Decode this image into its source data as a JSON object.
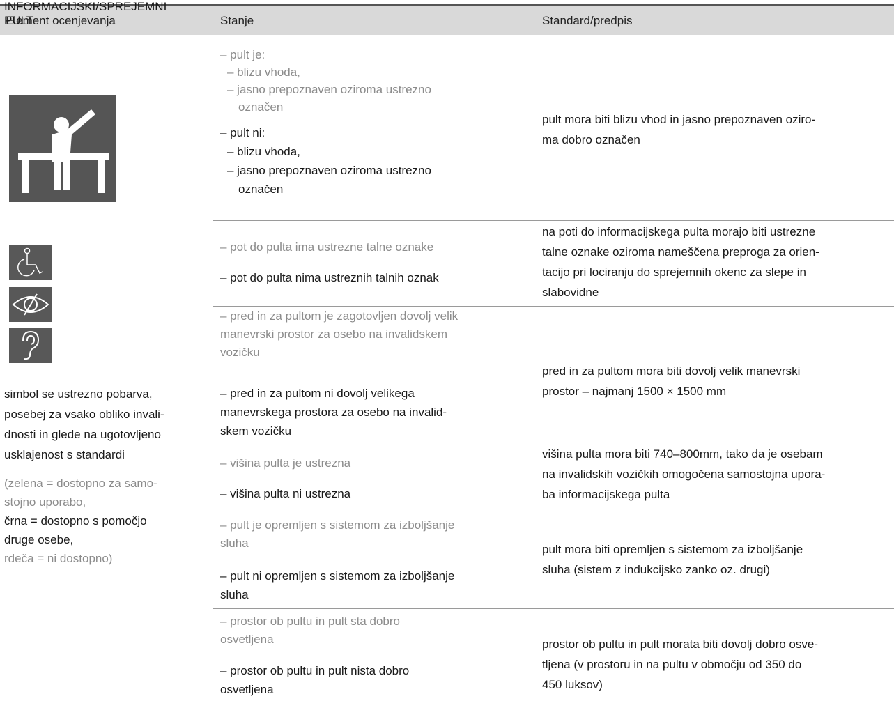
{
  "header": {
    "col1": "Element ocenjevanja",
    "col2": "Stanje",
    "col3": "Standard/predpis"
  },
  "left": {
    "title_line1": "INFORMACIJSKI/SPREJEMNI",
    "title_line2": "PULT",
    "icons": [
      "reception-desk-icon",
      "wheelchair-icon",
      "eye-icon",
      "ear-icon"
    ],
    "note_lines": [
      "simbol se ustrezno pobarva,",
      "posebej za vsako obliko invali-",
      "dnosti in glede na ugotovljeno",
      "usklajenost s standardi"
    ],
    "legend_lines": [
      "(zelena = dostopno za samo-",
      "stojno uporabo,",
      "črna = dostopno s pomočjo",
      "druge osebe,",
      "rdeča = ni dostopno)"
    ]
  },
  "rows": [
    {
      "ok_lines": [
        "– pult je:",
        "  – blizu vhoda,",
        "  – jasno prepoznaven oziroma ustrezno",
        "    označen"
      ],
      "not_lines": [
        "– pult ni:",
        "  – blizu vhoda,",
        "  – jasno prepoznaven oziroma ustrezno",
        "    označen"
      ],
      "standard_lines": [
        "pult mora biti blizu vhod in jasno prepoznaven oziro-",
        "ma dobro označen"
      ]
    },
    {
      "ok_lines": [
        "– pot do pulta ima ustrezne talne oznake"
      ],
      "not_lines": [
        "– pot do pulta nima ustreznih talnih oznak"
      ],
      "standard_lines": [
        "na poti do informacijskega pulta morajo biti ustrezne",
        "talne oznake oziroma nameščena preproga za orien-",
        "tacijo pri lociranju do sprejemnih okenc za slepe in",
        "slabovidne"
      ]
    },
    {
      "ok_lines": [
        "– pred in za pultom je zagotovljen dovolj velik",
        "manevrski prostor za osebo na invalidskem",
        "vozičku"
      ],
      "not_lines": [
        "– pred in za pultom ni dovolj velikega",
        "manevrskega prostora za osebo na invalid-",
        "skem vozičku"
      ],
      "standard_lines": [
        "pred in za pultom mora biti dovolj velik manevrski",
        "prostor – najmanj 1500 × 1500 mm"
      ]
    },
    {
      "ok_lines": [
        "– višina pulta je ustrezna"
      ],
      "not_lines": [
        "– višina pulta ni ustrezna"
      ],
      "standard_lines": [
        "višina pulta mora biti 740–800mm, tako da je osebam",
        "na invalidskih vozičkih omogočena samostojna upora-",
        "ba informacijskega pulta"
      ]
    },
    {
      "ok_lines": [
        "– pult je opremljen s sistemom za izboljšanje",
        "sluha"
      ],
      "not_lines": [
        "– pult ni opremljen s sistemom za izboljšanje",
        "sluha"
      ],
      "standard_lines": [
        "pult mora biti opremljen s sistemom za izboljšanje",
        "sluha (sistem z indukcijsko zanko oz. drugi)"
      ]
    },
    {
      "ok_lines": [
        "– prostor ob pultu in pult sta dobro",
        "osvetljena"
      ],
      "not_lines": [
        "– prostor ob pultu in pult nista dobro",
        "osvetljena"
      ],
      "standard_lines": [
        "prostor ob pultu in pult morata biti dovolj dobro osve-",
        "tljena (v prostoru in na pultu v območju od 350 do",
        "450 luksov)"
      ]
    }
  ]
}
